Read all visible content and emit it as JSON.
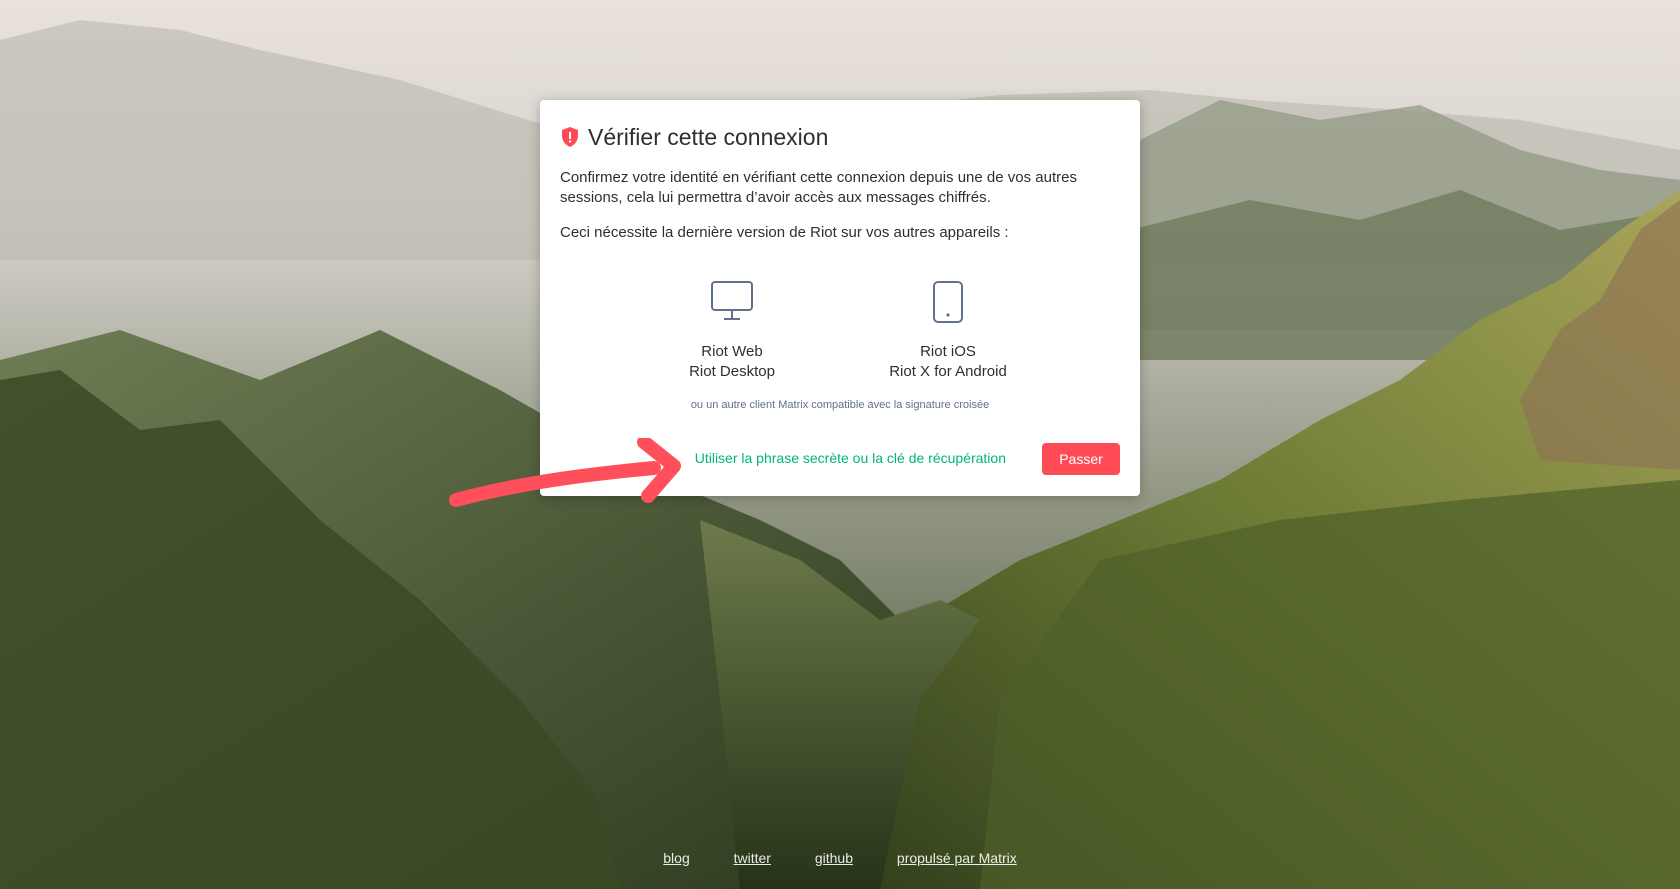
{
  "dialog": {
    "title": "Vérifier cette connexion",
    "description": "Confirmez votre identité en vérifiant cette connexion depuis une de vos autres sessions, cela lui permettra d’avoir accès aux messages chiffrés.",
    "requirement": "Ceci nécessite la dernière version de Riot sur vos autres appareils :",
    "clients": [
      {
        "icon": "desktop-icon",
        "line1": "Riot Web",
        "line2": "Riot Desktop"
      },
      {
        "icon": "phone-icon",
        "line1": "Riot iOS",
        "line2": "Riot X for Android"
      }
    ],
    "note": "ou un autre client Matrix compatible avec la signature croisée",
    "recovery_link": "Utiliser la phrase secrète ou la clé de récupération",
    "skip_button": "Passer"
  },
  "footer": {
    "links": [
      "blog",
      "twitter",
      "github",
      "propulsé par Matrix"
    ]
  },
  "colors": {
    "accent_green": "#03b381",
    "button_red": "#ff4b55",
    "shield_red": "#ff4b55",
    "icon_blue": "#61708b",
    "annotation_arrow": "#ff4f5a"
  }
}
